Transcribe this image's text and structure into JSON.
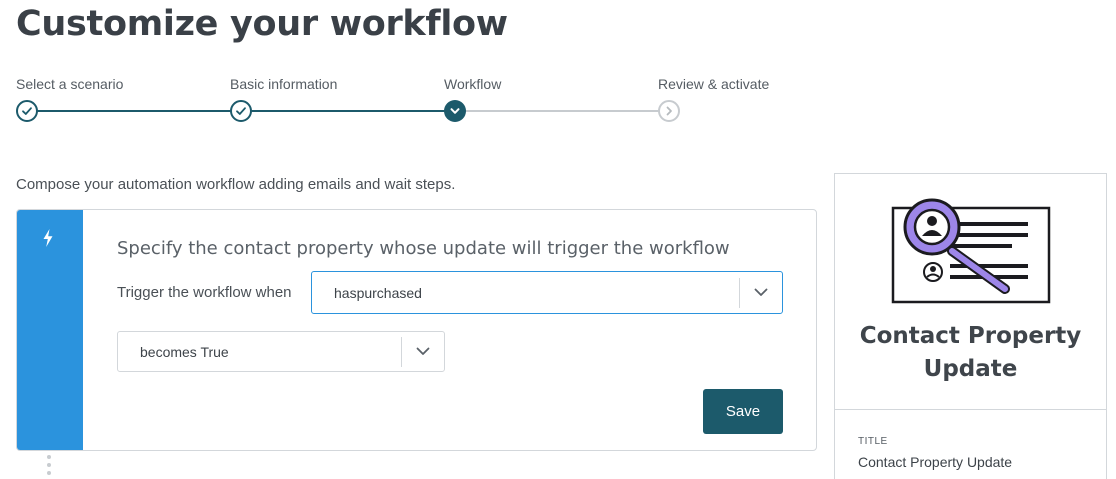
{
  "page": {
    "title": "Customize your workflow"
  },
  "stepper": {
    "steps": [
      {
        "label": "Select a scenario",
        "status": "completed"
      },
      {
        "label": "Basic information",
        "status": "completed"
      },
      {
        "label": "Workflow",
        "status": "current"
      },
      {
        "label": "Review & activate",
        "status": "upcoming"
      }
    ]
  },
  "intro": "Compose your automation workflow adding emails and wait steps.",
  "trigger": {
    "icon": "lightning-bolt-icon",
    "heading": "Specify the contact property whose update will trigger the workflow",
    "label": "Trigger the workflow when",
    "property_value": "haspurchased",
    "condition_value": "becomes True",
    "save_label": "Save"
  },
  "side_panel": {
    "illustration": "contact-search-illustration",
    "title_line1": "Contact Property",
    "title_line2": "Update",
    "field_caption": "TITLE",
    "field_value": "Contact Property Update"
  },
  "colors": {
    "accent_blue": "#2b93dd",
    "primary_teal": "#1c5a6b",
    "illustration_purple": "#9d86e9"
  }
}
